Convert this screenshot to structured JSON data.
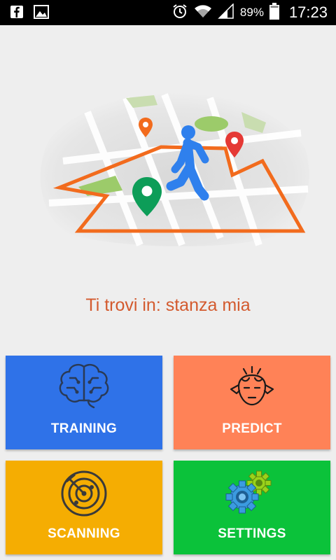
{
  "status_bar": {
    "battery_percent": "89%",
    "time": "17:23",
    "icons": [
      "facebook-icon",
      "gallery-icon",
      "alarm-icon",
      "wifi-icon",
      "signal-icon",
      "battery-icon"
    ]
  },
  "location": {
    "text": "Ti trovi in: stanza mia",
    "color": "#d35a2e"
  },
  "tiles": {
    "training": {
      "label": "TRAINING",
      "icon": "brain-icon",
      "color": "#2f72e8"
    },
    "predict": {
      "label": "PREDICT",
      "icon": "thinking-head-icon",
      "color": "#ff8257"
    },
    "scanning": {
      "label": "SCANNING",
      "icon": "radar-icon",
      "color": "#f5ad02"
    },
    "settings": {
      "label": "SETTINGS",
      "icon": "gears-icon",
      "color": "#0bc23a"
    }
  }
}
